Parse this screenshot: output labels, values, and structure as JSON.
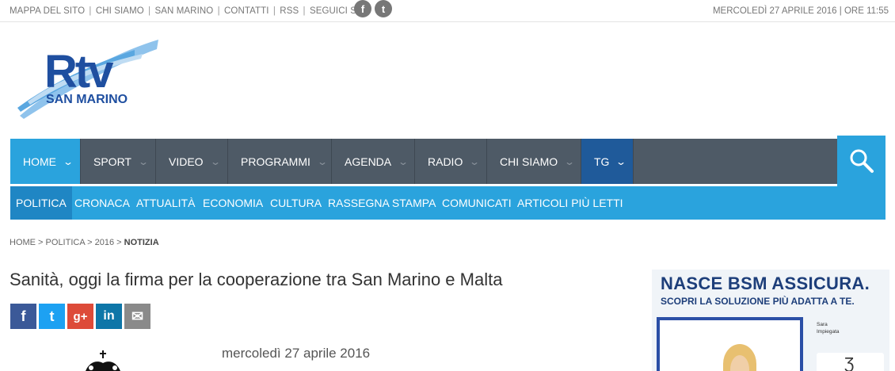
{
  "topbar": {
    "links": [
      "MAPPA DEL SITO",
      "CHI SIAMO",
      "SAN MARINO",
      "CONTATTI",
      "RSS",
      "SEGUICI SU:"
    ],
    "social": [
      {
        "icon": "facebook-icon",
        "glyph": "f"
      },
      {
        "icon": "twitter-icon",
        "glyph": "t"
      }
    ],
    "datetime": "MERCOLEDÌ 27 APRILE 2016 | ORE 11:55"
  },
  "logo": {
    "main": "Rtv",
    "sub": "SAN MARINO",
    "colors": {
      "primary": "#1f4fa0",
      "swoosh": "#5aa7e0"
    }
  },
  "nav": {
    "items": [
      {
        "label": "HOME"
      },
      {
        "label": "SPORT"
      },
      {
        "label": "VIDEO"
      },
      {
        "label": "PROGRAMMI"
      },
      {
        "label": "AGENDA"
      },
      {
        "label": "RADIO"
      },
      {
        "label": "CHI SIAMO"
      },
      {
        "label": "TG"
      }
    ],
    "active": "HOME",
    "colors": {
      "bar": "#4e5a66",
      "active": "#2aa3dd",
      "tg": "#1f5a9a"
    }
  },
  "subnav": {
    "items": [
      "POLITICA",
      "CRONACA",
      "ATTUALITÀ",
      "ECONOMIA",
      "CULTURA",
      "RASSEGNA STAMPA",
      "COMUNICATI",
      "ARTICOLI PIÙ LETTI"
    ],
    "active": "POLITICA"
  },
  "breadcrumb": {
    "items": [
      "HOME",
      "POLITICA",
      "2016"
    ],
    "current": "NOTIZIA"
  },
  "article": {
    "title": "Sanità, oggi la firma per la cooperazione tra San Marino e Malta",
    "date": "mercoledì 27 aprile 2016",
    "share": [
      {
        "icon": "facebook-icon",
        "glyph": "f"
      },
      {
        "icon": "twitter-icon",
        "glyph": "t"
      },
      {
        "icon": "google-plus-icon",
        "glyph": "g+"
      },
      {
        "icon": "linkedin-icon",
        "glyph": "in"
      },
      {
        "icon": "mail-icon",
        "glyph": "✉"
      }
    ]
  },
  "ad": {
    "title": "NASCE BSM ASSICURA.",
    "subtitle": "SCOPRI LA SOLUZIONE PIÙ ADATTA A TE.",
    "person_name": "Sara",
    "person_role": "Impiegata"
  }
}
